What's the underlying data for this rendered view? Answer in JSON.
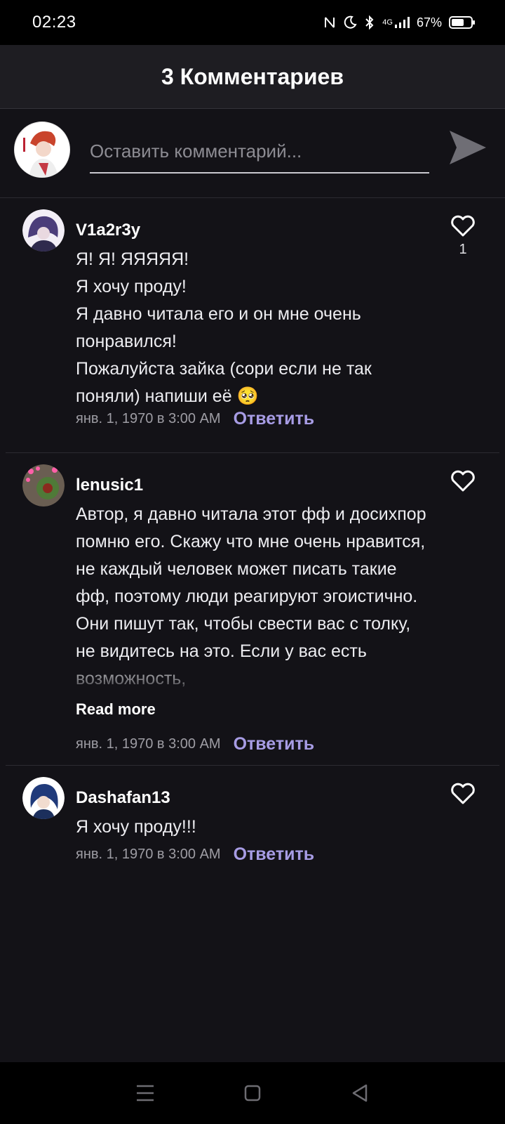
{
  "status": {
    "time": "02:23",
    "network": "4G",
    "battery": "67%",
    "battery_level": 0.67
  },
  "header": {
    "title": "3 Комментариев"
  },
  "composer": {
    "placeholder": "Оставить комментарий..."
  },
  "comments": [
    {
      "username": "V1a2r3y",
      "text": "Я! Я! ЯЯЯЯЯ!\nЯ хочу проду!\nЯ давно читала его и он мне очень понравился!\nПожалуйста зайка (сори если не так поняли) напиши её 🥺",
      "likes": "1",
      "timestamp": "янв. 1, 1970 в 3:00 AM",
      "reply_label": "Ответить"
    },
    {
      "username": "lenusic1",
      "text": "Автор, я давно читала этот фф и досихпор помню его. Скажу что мне очень нравится, не каждый человек может писать такие фф, поэтому люди реагируют эгоистично. Они пишут так, чтобы свести вас с толку, не видитесь на это. Если у вас есть возможность,",
      "read_more": "Read more",
      "timestamp": "янв. 1, 1970 в 3:00 AM",
      "reply_label": "Ответить"
    },
    {
      "username": "Dashafan13",
      "text": "Я хочу проду!!!",
      "timestamp": "янв. 1, 1970 в 3:00 AM",
      "reply_label": "Ответить"
    }
  ],
  "colors": {
    "background": "#131217",
    "header": "#1e1d22",
    "reply_link": "#a79ce4",
    "timestamp": "#9e9da4"
  },
  "icons": {
    "send": "send-icon",
    "like": "heart-outline-icon",
    "nav": [
      "menu-icon",
      "home-square-icon",
      "back-triangle-icon"
    ]
  }
}
